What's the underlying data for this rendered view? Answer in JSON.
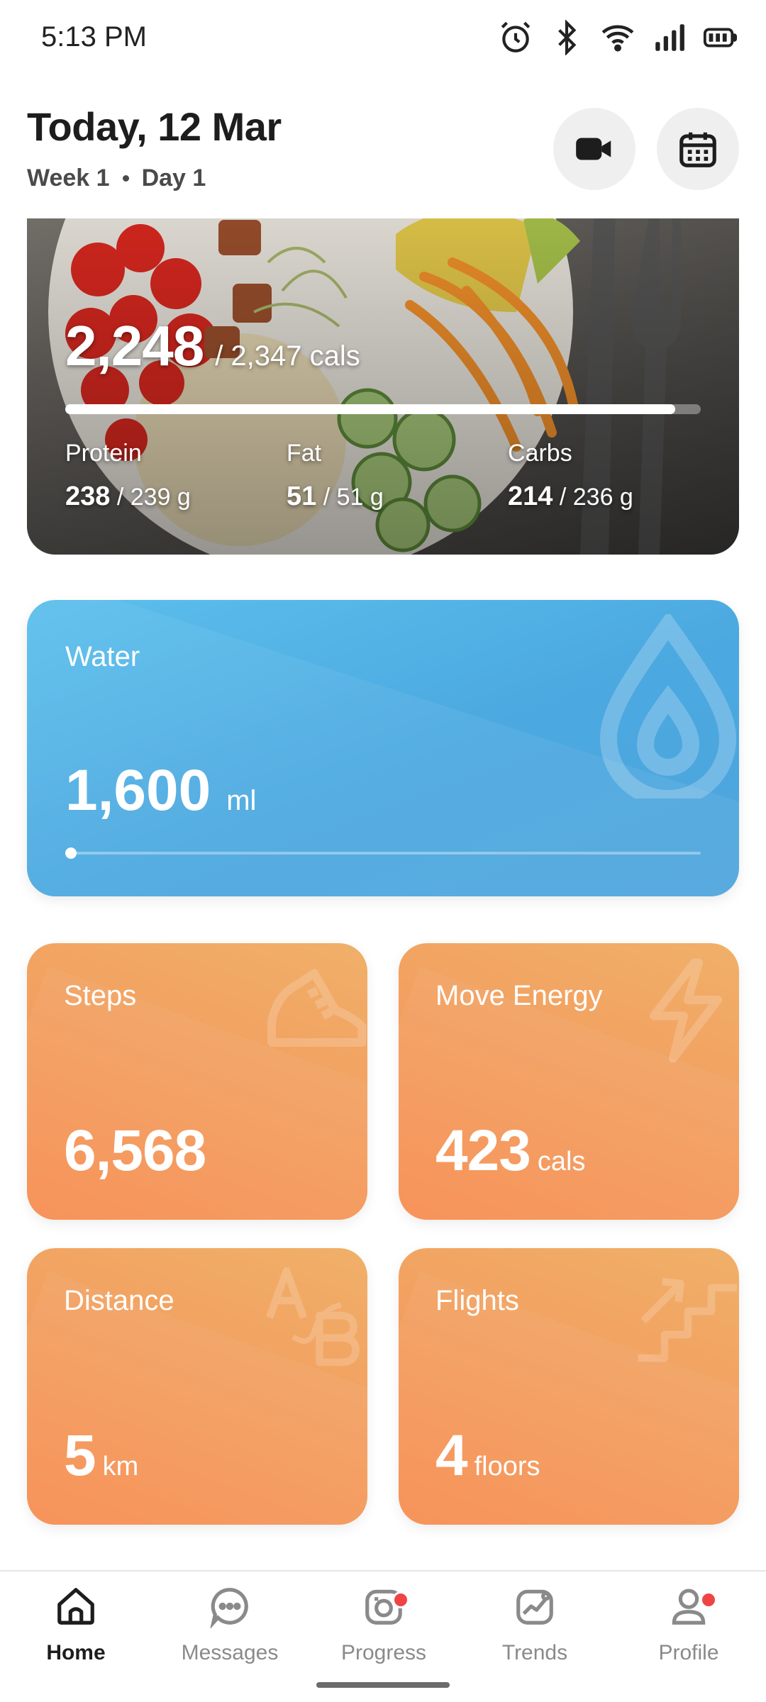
{
  "status_bar": {
    "time": "5:13 PM",
    "icons": [
      "alarm-icon",
      "bluetooth-icon",
      "wifi-icon",
      "signal-icon",
      "battery-icon"
    ]
  },
  "header": {
    "title": "Today, 12 Mar",
    "week": "Week 1",
    "day": "Day 1",
    "buttons": [
      "video-camera-icon",
      "calendar-icon"
    ]
  },
  "nutrition": {
    "calories_consumed": "2,248",
    "calories_target": "/ 2,347 cals",
    "calories_progress": 0.96,
    "macros": {
      "protein": {
        "label": "Protein",
        "value": "238",
        "target": "/ 239 g"
      },
      "fat": {
        "label": "Fat",
        "value": "51",
        "target": "/ 51 g"
      },
      "carbs": {
        "label": "Carbs",
        "value": "214",
        "target": "/ 236 g"
      }
    }
  },
  "water": {
    "label": "Water",
    "value": "1,600",
    "unit": "ml",
    "progress": 0.0,
    "icon": "water-drop-icon"
  },
  "stats": {
    "steps": {
      "label": "Steps",
      "value": "6,568",
      "unit": "",
      "icon": "shoe-icon"
    },
    "move_energy": {
      "label": "Move Energy",
      "value": "423",
      "unit": "cals",
      "icon": "lightning-icon"
    },
    "distance": {
      "label": "Distance",
      "value": "5",
      "unit": "km",
      "icon": "a-to-b-icon"
    },
    "flights": {
      "label": "Flights",
      "value": "4",
      "unit": "floors",
      "icon": "stairs-icon"
    }
  },
  "colors": {
    "water_card": "#4fa9e0",
    "stat_card": "#f49a5c",
    "notification_dot": "#ef4444"
  },
  "nav": {
    "items": [
      {
        "label": "Home",
        "icon": "home-icon",
        "active": true,
        "badge": false
      },
      {
        "label": "Messages",
        "icon": "messages-icon",
        "active": false,
        "badge": false
      },
      {
        "label": "Progress",
        "icon": "progress-camera-icon",
        "active": false,
        "badge": true
      },
      {
        "label": "Trends",
        "icon": "trends-icon",
        "active": false,
        "badge": false
      },
      {
        "label": "Profile",
        "icon": "profile-icon",
        "active": false,
        "badge": true
      }
    ]
  }
}
